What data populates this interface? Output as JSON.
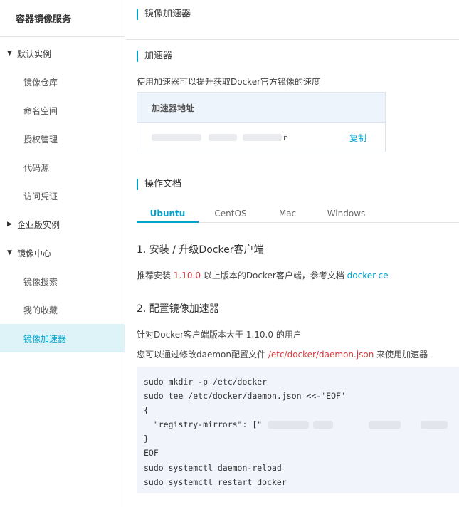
{
  "sidebar": {
    "title": "容器镜像服务",
    "groups": [
      {
        "label": "默认实例",
        "caret": "▼",
        "items": [
          "镜像仓库",
          "命名空间",
          "授权管理",
          "代码源",
          "访问凭证"
        ]
      },
      {
        "label": "企业版实例",
        "caret": "▶",
        "items": []
      },
      {
        "label": "镜像中心",
        "caret": "▼",
        "items": [
          "镜像搜索",
          "我的收藏",
          "镜像加速器"
        ]
      }
    ],
    "active_item": "镜像加速器"
  },
  "page": {
    "title": "镜像加速器"
  },
  "accelerator": {
    "section_title": "加速器",
    "description": "使用加速器可以提升获取Docker官方镜像的速度",
    "address_header": "加速器地址",
    "address_visible_tail": "n",
    "copy_label": "复制"
  },
  "docs": {
    "section_title": "操作文档",
    "tabs": [
      "Ubuntu",
      "CentOS",
      "Mac",
      "Windows"
    ],
    "active_tab": "Ubuntu",
    "step1": {
      "title": "1. 安装 / 升级Docker客户端",
      "text_before": "推荐安装 ",
      "version": "1.10.0",
      "text_middle": " 以上版本的Docker客户端，参考文档 ",
      "link": "docker-ce"
    },
    "step2": {
      "title": "2. 配置镜像加速器",
      "line1": "针对Docker客户端版本大于 1.10.0 的用户",
      "line2_before": "您可以通过修改daemon配置文件 ",
      "line2_path": "/etc/docker/daemon.json",
      "line2_after": " 来使用加速器"
    },
    "code": [
      "sudo mkdir -p /etc/docker",
      "sudo tee /etc/docker/daemon.json <<-'EOF'",
      "{",
      "  \"registry-mirrors\": [\"",
      "}",
      "EOF",
      "sudo systemctl daemon-reload",
      "sudo systemctl restart docker"
    ]
  }
}
